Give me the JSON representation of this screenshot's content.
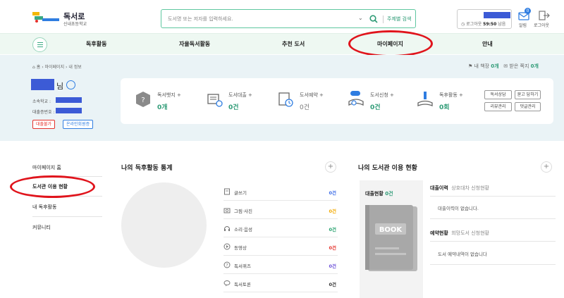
{
  "header": {
    "logo_name": "독서로",
    "school": "신내초등학교",
    "search_placeholder": "도서명 또는 저자를 입력하세요.",
    "search_theme": "주제별 검색",
    "timer_label": "로그아웃",
    "timer_time": "59:50",
    "timer_suffix": "남음",
    "notice_count": "0",
    "alarm_label": "알림",
    "logout_label": "로그아웃"
  },
  "nav": {
    "items": [
      "독후활동",
      "자율독서활동",
      "추천 도서",
      "마이페이지",
      "안내"
    ]
  },
  "breadcrumb": {
    "items": [
      "홈",
      "마이페이지",
      "내 정보"
    ],
    "my_shelf_label": "내 책장",
    "my_shelf_count": "0개",
    "received_label": "받은 쪽지",
    "received_count": "0개"
  },
  "profile": {
    "suffix": "님",
    "school_label": "소속학교 :",
    "card_label": "대출증번호 :",
    "tag_loan": "대출불가",
    "tag_member": "온라인회원증"
  },
  "stats": [
    {
      "label": "독서뱃지 +",
      "value": "0개",
      "highlight": true
    },
    {
      "label": "도서대출 +",
      "value": "0건",
      "highlight": true
    },
    {
      "label": "도서예약 +",
      "value": "0건",
      "highlight": false
    },
    {
      "label": "도서신청 +",
      "value": "0건",
      "highlight": true,
      "badge": "희망"
    },
    {
      "label": "독후활동 +",
      "value": "0회",
      "highlight": true
    }
  ],
  "quick_links": [
    "독서상담",
    "묻고 답하기",
    "리뷰관리",
    "댓글관리"
  ],
  "left_menu": [
    "마이페이지 홈",
    "도서관 이용 현황",
    "내 독후활동",
    "커뮤니티"
  ],
  "activity": {
    "title": "나의 독후활동 통계",
    "rows": [
      {
        "name": "글쓰기",
        "value": "0건",
        "color": "#3a6be6"
      },
      {
        "name": "그림·사진",
        "value": "0건",
        "color": "#f2a900"
      },
      {
        "name": "소리·음성",
        "value": "0건",
        "color": "#22a06b"
      },
      {
        "name": "동영상",
        "value": "0건",
        "color": "#e5312b"
      },
      {
        "name": "독서퀴즈",
        "value": "0건",
        "color": "#6b4fd8"
      },
      {
        "name": "독서토론",
        "value": "0건",
        "color": "#333333"
      }
    ]
  },
  "library": {
    "title": "나의 도서관 이용 현황",
    "loan_status_label": "대출현황",
    "loan_status_count": "0건",
    "book_label": "BOOK",
    "loan_history_title": "대출이력",
    "loan_history_sub": "상호대차 신청현황",
    "loan_history_empty": "대출이력이 없습니다.",
    "reserve_title": "예약현황",
    "reserve_sub": "희망도서 신청현황",
    "reserve_empty": "도서 예약내역이 없습니다"
  }
}
